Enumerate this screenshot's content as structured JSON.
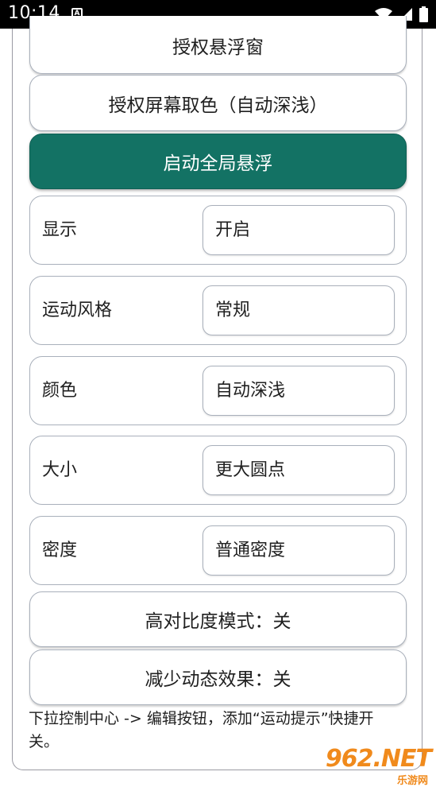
{
  "status": {
    "time": "10:14",
    "notification_icon": "a-box-icon",
    "wifi_icon": "wifi-icon",
    "signal_icon": "signal-icon",
    "battery_icon": "battery-icon"
  },
  "buttons": {
    "authorize_overlay": "授权悬浮窗",
    "authorize_color": "授权屏幕取色（自动深浅）",
    "start_overlay": "启动全局悬浮",
    "high_contrast": "高对比度模式：关",
    "reduce_motion": "减少动态效果：关"
  },
  "settings": [
    {
      "label": "显示",
      "value": "开启"
    },
    {
      "label": "运动风格",
      "value": "常规"
    },
    {
      "label": "颜色",
      "value": "自动深浅"
    },
    {
      "label": "大小",
      "value": "更大圆点"
    },
    {
      "label": "密度",
      "value": "普通密度"
    }
  ],
  "footnote": "下拉控制中心 -> 编辑按钮，添加“运动提示”快捷开关。",
  "watermark": {
    "logo": "962.NET",
    "sub": "乐游网"
  },
  "colors": {
    "primary": "#137264",
    "border": "#a9b0bb",
    "watermark": "#f08a1c"
  }
}
